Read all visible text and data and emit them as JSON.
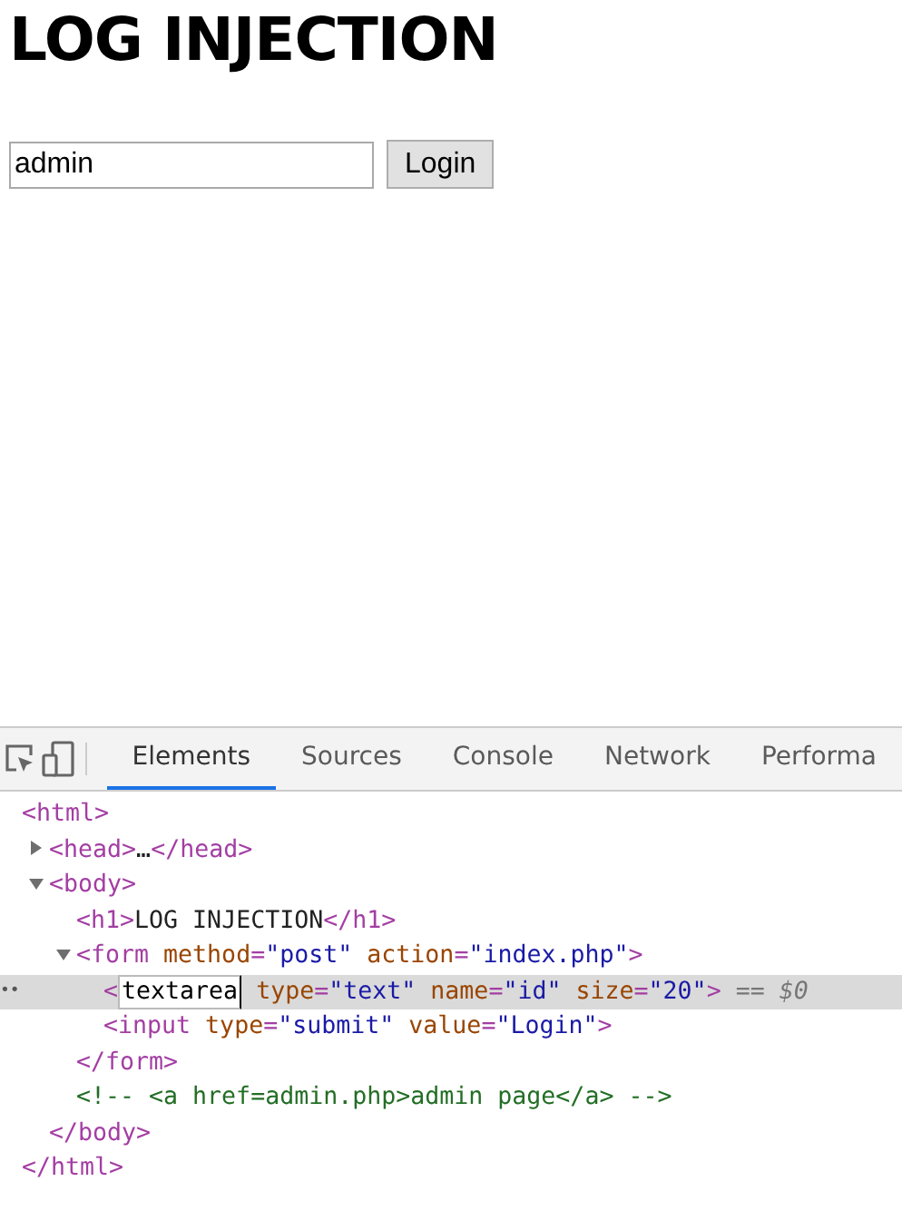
{
  "page": {
    "heading": "LOG INJECTION",
    "login_field": {
      "value": "admin"
    },
    "login_button": "Login"
  },
  "devtools": {
    "tabs": [
      {
        "label": "Elements",
        "selected": true
      },
      {
        "label": "Sources",
        "selected": false
      },
      {
        "label": "Console",
        "selected": false
      },
      {
        "label": "Network",
        "selected": false
      },
      {
        "label": "Performa",
        "selected": false
      }
    ],
    "tree": [
      {
        "open": [
          {
            "kind": "tag",
            "text": "<html>"
          }
        ],
        "selected": false,
        "children": [
          {
            "open": [
              {
                "kind": "tag",
                "text": "<head>"
              },
              {
                "kind": "text",
                "text": "…"
              },
              {
                "kind": "tag",
                "text": "</head>"
              }
            ],
            "expanded": false,
            "selected": false
          },
          {
            "open": [
              {
                "kind": "tag",
                "text": "<body>"
              }
            ],
            "expanded": true,
            "selected": false,
            "children": [
              {
                "open": [
                  {
                    "kind": "tag",
                    "text": "<h1>"
                  },
                  {
                    "kind": "text",
                    "text": "LOG INJECTION"
                  },
                  {
                    "kind": "tag",
                    "text": "</h1>"
                  }
                ],
                "selected": false
              },
              {
                "open": [
                  {
                    "kind": "tag",
                    "text": "<form"
                  },
                  {
                    "kind": "attr",
                    "text": " method"
                  },
                  {
                    "kind": "tag",
                    "text": "="
                  },
                  {
                    "kind": "value",
                    "text": "\"post\""
                  },
                  {
                    "kind": "attr",
                    "text": " action"
                  },
                  {
                    "kind": "tag",
                    "text": "="
                  },
                  {
                    "kind": "value",
                    "text": "\"index.php\""
                  },
                  {
                    "kind": "tag",
                    "text": ">"
                  }
                ],
                "expanded": true,
                "selected": false,
                "children": [
                  {
                    "open": [
                      {
                        "kind": "tag",
                        "text": "<"
                      },
                      {
                        "kind": "editor",
                        "text": "textarea"
                      },
                      {
                        "kind": "attr",
                        "text": " type"
                      },
                      {
                        "kind": "tag",
                        "text": "="
                      },
                      {
                        "kind": "value",
                        "text": "\"text\""
                      },
                      {
                        "kind": "attr",
                        "text": " name"
                      },
                      {
                        "kind": "tag",
                        "text": "="
                      },
                      {
                        "kind": "value",
                        "text": "\"id\""
                      },
                      {
                        "kind": "attr",
                        "text": " size"
                      },
                      {
                        "kind": "tag",
                        "text": "="
                      },
                      {
                        "kind": "value",
                        "text": "\"20\""
                      },
                      {
                        "kind": "tag",
                        "text": ">"
                      },
                      {
                        "kind": "marker",
                        "text": " == $0"
                      }
                    ],
                    "selected": true,
                    "ellipsis": "••"
                  },
                  {
                    "open": [
                      {
                        "kind": "tag",
                        "text": "<input"
                      },
                      {
                        "kind": "attr",
                        "text": " type"
                      },
                      {
                        "kind": "tag",
                        "text": "="
                      },
                      {
                        "kind": "value",
                        "text": "\"submit\""
                      },
                      {
                        "kind": "attr",
                        "text": " value"
                      },
                      {
                        "kind": "tag",
                        "text": "="
                      },
                      {
                        "kind": "value",
                        "text": "\"Login\""
                      },
                      {
                        "kind": "tag",
                        "text": ">"
                      }
                    ],
                    "selected": false
                  }
                ],
                "close": [
                  {
                    "kind": "tag",
                    "text": "</form>"
                  }
                ]
              },
              {
                "open": [
                  {
                    "kind": "comment",
                    "text": "<!-- <a href=admin.php>admin page</a> -->"
                  }
                ],
                "selected": false
              }
            ],
            "close": [
              {
                "kind": "tag",
                "text": "</body>"
              }
            ]
          }
        ],
        "close": [
          {
            "kind": "tag",
            "text": "</html>"
          }
        ]
      }
    ]
  }
}
